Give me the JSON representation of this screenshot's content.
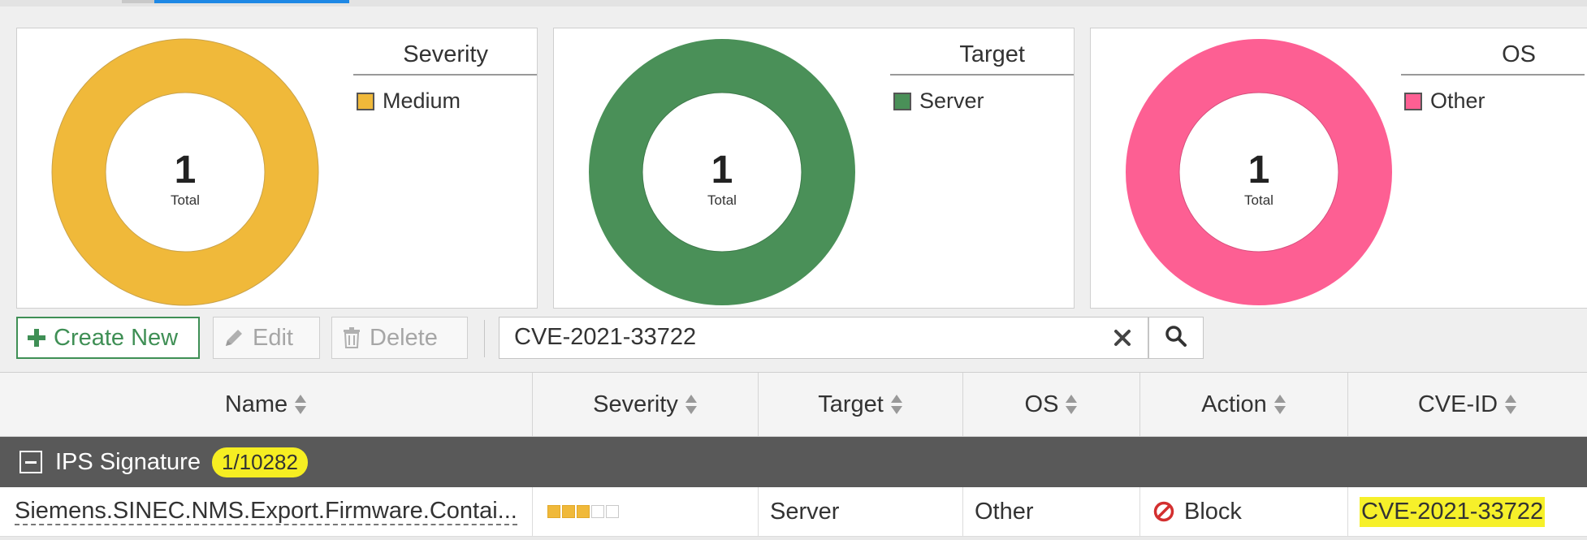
{
  "colors": {
    "severity_medium": "#f0b93a",
    "target_server": "#4a9058",
    "os_other": "#fd5f93",
    "accent_green": "#3f8f55",
    "highlight": "#f6f02a",
    "group_bg": "#595959",
    "block_red": "#d32f2f"
  },
  "charts": [
    {
      "legend_title": "Severity",
      "total_value": "1",
      "total_label": "Total",
      "legend_items": [
        {
          "label": "Medium",
          "color": "#f0b93a"
        }
      ]
    },
    {
      "legend_title": "Target",
      "total_value": "1",
      "total_label": "Total",
      "legend_items": [
        {
          "label": "Server",
          "color": "#4a9058"
        }
      ]
    },
    {
      "legend_title": "OS",
      "total_value": "1",
      "total_label": "Total",
      "legend_items": [
        {
          "label": "Other",
          "color": "#fd5f93"
        }
      ]
    }
  ],
  "toolbar": {
    "create_label": "Create New",
    "edit_label": "Edit",
    "delete_label": "Delete",
    "search_value": "CVE-2021-33722"
  },
  "table": {
    "columns": [
      "Name",
      "Severity",
      "Target",
      "OS",
      "Action",
      "CVE-ID"
    ],
    "group": {
      "title": "IPS Signature",
      "count": "1/10282"
    },
    "rows": [
      {
        "name": "Siemens.SINEC.NMS.Export.Firmware.Contai...",
        "severity_level": 3,
        "severity_max": 5,
        "target": "Server",
        "os": "Other",
        "action": "Block",
        "cve_id": "CVE-2021-33722"
      }
    ]
  }
}
